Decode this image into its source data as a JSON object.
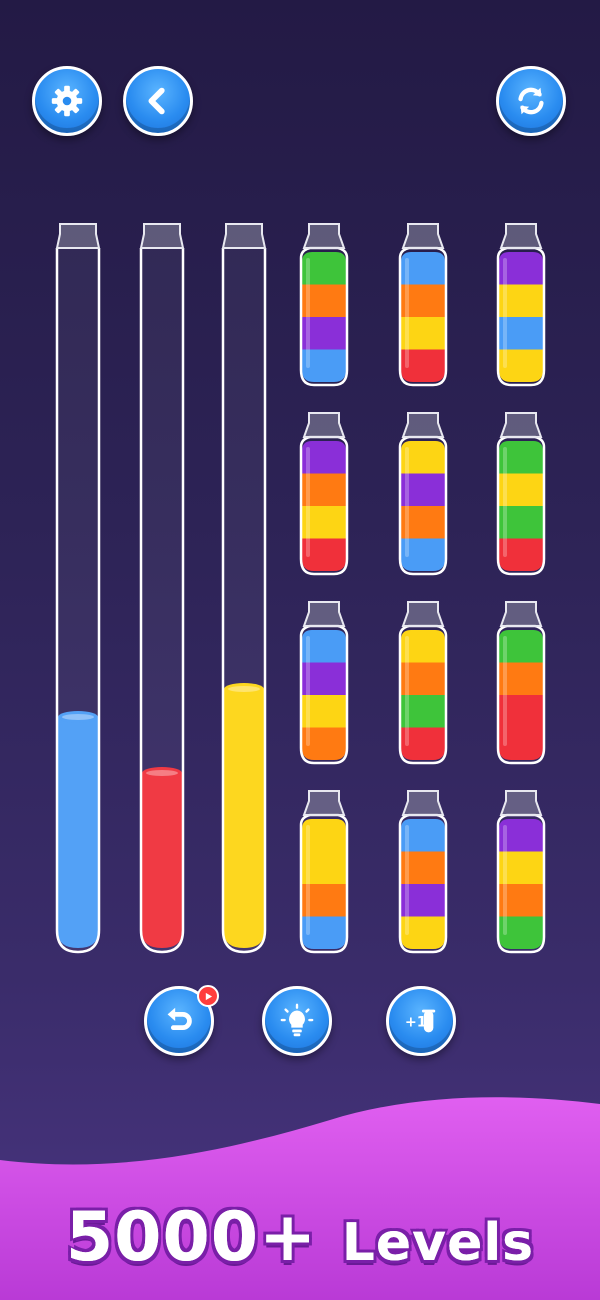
{
  "toolbar": {
    "settings_icon": "gear-icon",
    "back_icon": "chevron-left-icon",
    "restart_icon": "refresh-icon"
  },
  "colors": {
    "blue": "#4a9cf6",
    "red": "#f0303a",
    "yellow": "#fdd514",
    "green": "#3ec43a",
    "orange": "#ff7a12",
    "purple": "#8a2fd8",
    "glass": "#ffffff",
    "button": "#2a8cf0",
    "banner": "#d24fe6"
  },
  "tall_tubes": [
    {
      "segments": [
        "blue"
      ],
      "fill_fraction": 0.33
    },
    {
      "segments": [
        "red"
      ],
      "fill_fraction": 0.25
    },
    {
      "segments": [
        "yellow"
      ],
      "fill_fraction": 0.37
    }
  ],
  "bottles": [
    [
      "blue",
      "purple",
      "orange",
      "green"
    ],
    [
      "red",
      "yellow",
      "orange",
      "blue"
    ],
    [
      "yellow",
      "blue",
      "yellow",
      "purple"
    ],
    [
      "red",
      "yellow",
      "orange",
      "purple"
    ],
    [
      "blue",
      "orange",
      "purple",
      "yellow"
    ],
    [
      "red",
      "green",
      "yellow",
      "green"
    ],
    [
      "orange",
      "yellow",
      "purple",
      "blue"
    ],
    [
      "red",
      "green",
      "orange",
      "yellow"
    ],
    [
      "red",
      "red",
      "orange",
      "green"
    ],
    [
      "blue",
      "orange",
      "yellow",
      "yellow"
    ],
    [
      "yellow",
      "purple",
      "orange",
      "blue"
    ],
    [
      "green",
      "orange",
      "yellow",
      "purple"
    ]
  ],
  "actions": {
    "undo_icon": "undo-icon",
    "hint_icon": "lightbulb-icon",
    "add_tube_icon": "add-tube-icon",
    "add_tube_label": "+1",
    "video_badge_icon": "play-video-icon"
  },
  "banner": {
    "count": "5000+",
    "word": "Levels"
  }
}
